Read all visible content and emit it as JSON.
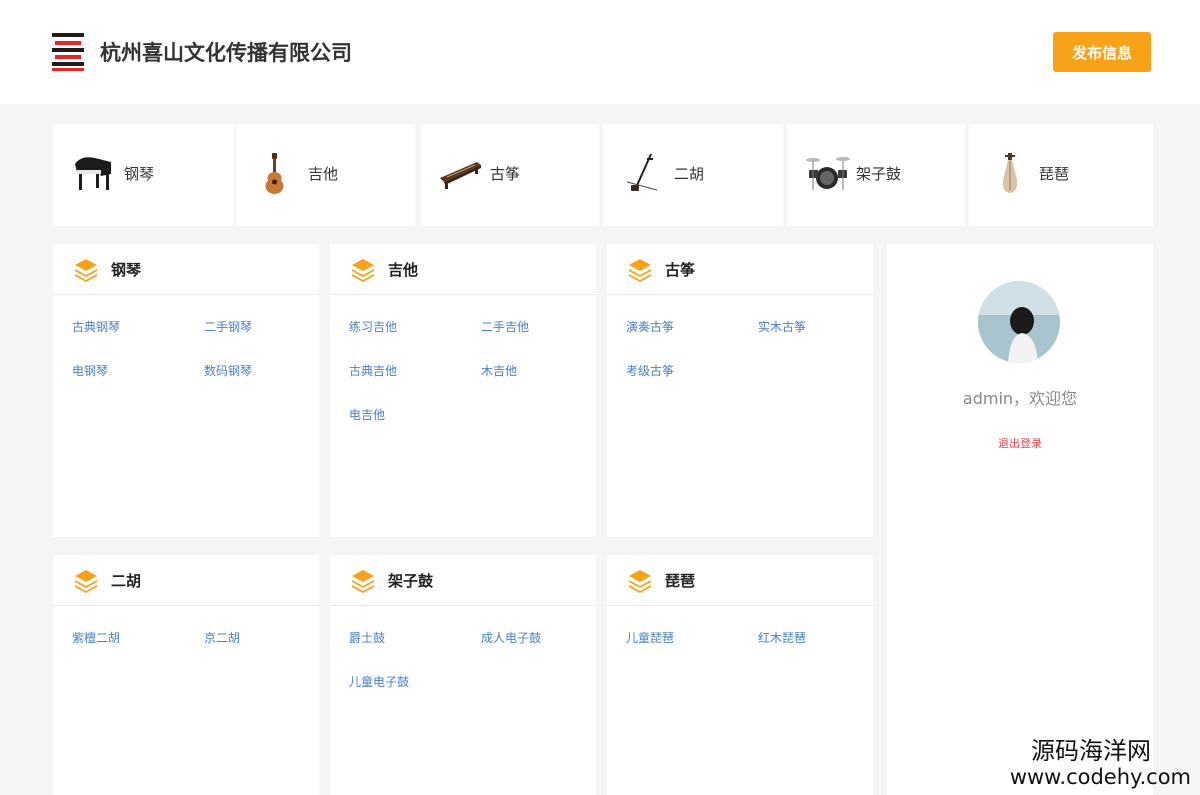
{
  "header": {
    "company_name": "杭州喜山文化传播有限公司",
    "publish_label": "发布信息",
    "accent_color": "#f7a217"
  },
  "instruments": [
    {
      "label": "钢琴",
      "icon": "piano-icon"
    },
    {
      "label": "吉他",
      "icon": "guitar-icon"
    },
    {
      "label": "古筝",
      "icon": "guzheng-icon"
    },
    {
      "label": "二胡",
      "icon": "erhu-icon"
    },
    {
      "label": "架子鼓",
      "icon": "drum-kit-icon"
    },
    {
      "label": "琵琶",
      "icon": "pipa-icon"
    }
  ],
  "categories": [
    {
      "title": "钢琴",
      "links": [
        "古典钢琴",
        "二手钢琴",
        "电钢琴",
        "数码钢琴"
      ]
    },
    {
      "title": "吉他",
      "links": [
        "练习吉他",
        "二手吉他",
        "古典吉他",
        "木吉他",
        "电吉他"
      ]
    },
    {
      "title": "古筝",
      "links": [
        "演奏古筝",
        "实木古筝",
        "考级古筝"
      ]
    },
    {
      "title": "二胡",
      "links": [
        "紫檀二胡",
        "京二胡"
      ]
    },
    {
      "title": "架子鼓",
      "links": [
        "爵士鼓",
        "成人电子鼓",
        "儿童电子鼓"
      ]
    },
    {
      "title": "琵琶",
      "links": [
        "儿童琵琶",
        "红木琵琶"
      ]
    }
  ],
  "profile": {
    "welcome": "admin，欢迎您",
    "logout_label": "退出登录"
  },
  "watermark": {
    "name": "源码海洋网",
    "url": "www.codehy.com"
  }
}
